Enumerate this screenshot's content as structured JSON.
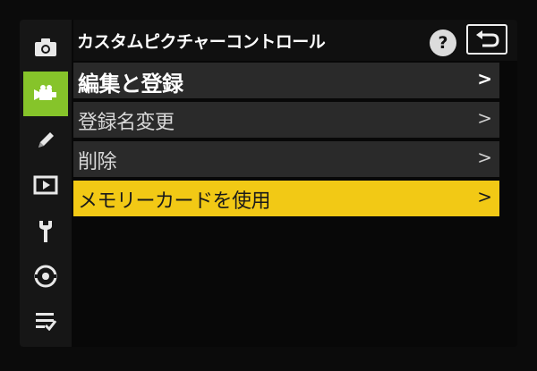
{
  "header": {
    "title": "カスタムピクチャーコントロール",
    "help_label": "?"
  },
  "rail": {
    "items": [
      {
        "icon": "camera-icon",
        "active": false
      },
      {
        "icon": "movie-camera-icon",
        "active": true
      },
      {
        "icon": "pencil-icon",
        "active": false
      },
      {
        "icon": "playback-icon",
        "active": false
      },
      {
        "icon": "wrench-icon",
        "active": false
      },
      {
        "icon": "network-icon",
        "active": false
      },
      {
        "icon": "my-menu-icon",
        "active": false
      }
    ],
    "accent_color": "#86c42a"
  },
  "menu": {
    "items": [
      {
        "label": "編集と登録",
        "chevron": ">",
        "selected": false
      },
      {
        "label": "登録名変更",
        "chevron": ">",
        "selected": false
      },
      {
        "label": "削除",
        "chevron": ">",
        "selected": false
      },
      {
        "label": "メモリーカードを使用",
        "chevron": ">",
        "selected": true
      }
    ],
    "highlight_color": "#f2c915"
  }
}
